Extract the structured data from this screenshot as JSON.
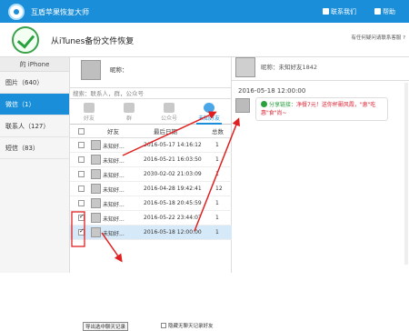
{
  "titlebar": {
    "title": "互盾苹果恢复大师",
    "contact_label": "联系我们",
    "help_label": "帮助"
  },
  "subheader": {
    "title": "从iTunes备份文件恢复",
    "help_text": "有任何疑问请联系客服 ?"
  },
  "sidebar": {
    "device": "的 iPhone",
    "items": [
      {
        "label": "图片（640）"
      },
      {
        "label": "微信（1）"
      },
      {
        "label": "联系人（127）"
      },
      {
        "label": "短信（83）"
      }
    ]
  },
  "contact_panel": {
    "nickname_label": "昵称：",
    "search_placeholder": "搜索：联系人，群，公众号"
  },
  "tabs": [
    {
      "label": "好友"
    },
    {
      "label": "群"
    },
    {
      "label": "公众号"
    },
    {
      "label": "未知好友"
    }
  ],
  "table": {
    "headers": [
      "好友",
      "最后日期",
      "总数"
    ],
    "rows": [
      {
        "name": "未知好...",
        "date": "2016-05-17 14:16:12",
        "count": "1",
        "checked": false,
        "selected": false
      },
      {
        "name": "未知好...",
        "date": "2016-05-21 16:03:50",
        "count": "1",
        "checked": false,
        "selected": false
      },
      {
        "name": "未知好...",
        "date": "2030-02-02 21:03:09",
        "count": "1",
        "checked": false,
        "selected": false
      },
      {
        "name": "未知好...",
        "date": "2016-04-28 19:42:41",
        "count": "12",
        "checked": false,
        "selected": false
      },
      {
        "name": "未知好...",
        "date": "2016-05-18 20:45:59",
        "count": "1",
        "checked": false,
        "selected": false
      },
      {
        "name": "未知好...",
        "date": "2016-05-22 23:44:07",
        "count": "1",
        "checked": true,
        "selected": false
      },
      {
        "name": "未知好...",
        "date": "2016-05-18 12:00:00",
        "count": "1",
        "checked": true,
        "selected": true
      }
    ]
  },
  "bottom": {
    "export_label": "导出选中聊天记录",
    "hide_label": "隐藏无聊天记录好友"
  },
  "chat": {
    "nickname": "昵称：未知好友1842",
    "date": "2016-05-18 12:00:00",
    "message_lead": "分享链接：",
    "message_body": "净餐7元！送你杯颞风霞，\"恵\"吃惠\"食\"尚~"
  },
  "colors": {
    "accent": "#1a8ed8",
    "arrow": "#e02020",
    "success": "#29a23e"
  }
}
